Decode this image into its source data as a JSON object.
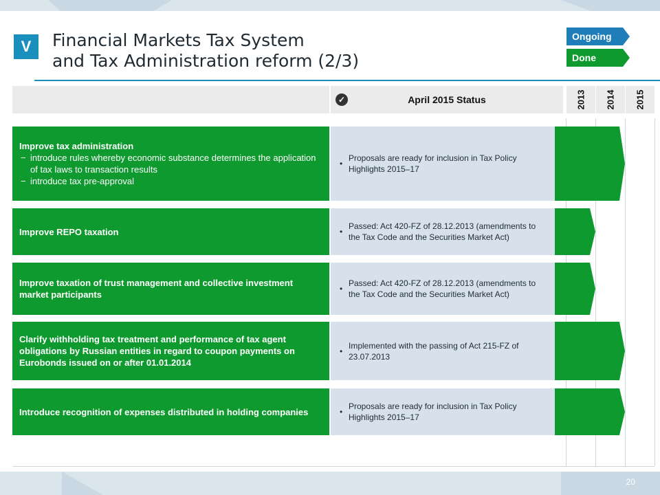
{
  "header": {
    "badge": "V",
    "title_line1": "Financial Markets Tax System",
    "title_line2": "and Tax Administration reform (2/3)"
  },
  "legend": {
    "ongoing": "Ongoing",
    "done": "Done"
  },
  "colors": {
    "accent": "#1a8fbd",
    "done": "#0e9a2e",
    "ongoing": "#1f7eb8",
    "status_bg": "#d6e1ec"
  },
  "table": {
    "status_header": "April 2015 Status",
    "years": [
      "2013",
      "2014",
      "2015"
    ],
    "rows": [
      {
        "title": "Improve tax administration",
        "bullets": [
          "introduce rules whereby economic substance determines the application of tax laws to transaction results",
          "introduce tax pre-approval"
        ],
        "status": "Proposals are ready for inclusion in Tax Policy Highlights 2015–17",
        "progress_end_year": 2015
      },
      {
        "title": "Improve REPO taxation",
        "status": "Passed: Act 420-FZ of 28.12.2013 (amendments to the Tax Code and the Securities Market Act)",
        "progress_end_year": 2014
      },
      {
        "title": "Improve taxation of trust management and collective investment market participants",
        "status": "Passed: Act 420-FZ of 28.12.2013 (amendments to the Tax Code and the Securities Market Act)",
        "progress_end_year": 2014
      },
      {
        "title": "Clarify withholding tax treatment and performance of tax agent obligations by Russian entities in regard to coupon payments on Eurobonds issued on or after 01.01.2014",
        "status": "Implemented with the passing of Act 215-FZ of 23.07.2013",
        "progress_end_year": 2015
      },
      {
        "title": "Introduce recognition of expenses distributed in holding companies",
        "status": "Proposals are ready for inclusion in Tax Policy Highlights 2015–17",
        "progress_end_year": 2015
      }
    ]
  },
  "footer": {
    "page_number": "20"
  }
}
